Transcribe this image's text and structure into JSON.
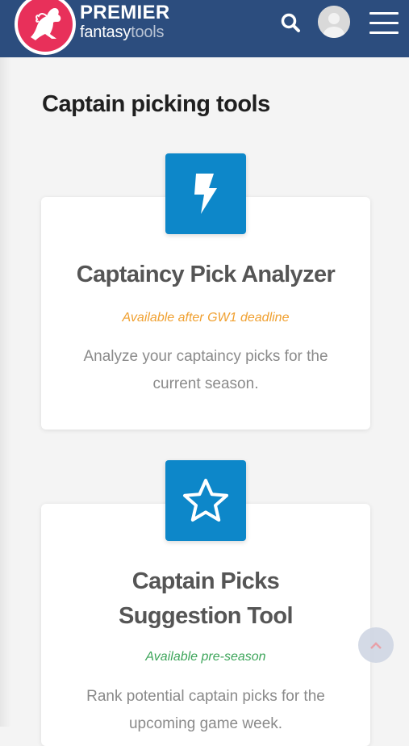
{
  "header": {
    "brand_line1": "PREMIER",
    "brand_fantasy": "fantasy",
    "brand_tools": "tools",
    "icons": [
      "logo-lion-icon",
      "search-icon",
      "avatar-icon",
      "hamburger-menu-icon"
    ],
    "brand_color": "#2c4d7e",
    "logo_color": "#e8305a"
  },
  "page": {
    "title": "Captain picking tools"
  },
  "cards": [
    {
      "icon": "lightning-bolt-icon",
      "title": "Captaincy Pick Analyzer",
      "status": "Available after GW1 deadline",
      "status_color": "#f0a030",
      "description": "Analyze your captaincy picks for the current season."
    },
    {
      "icon": "star-icon",
      "title_line1": "Captain Picks",
      "title_line2": "Suggestion Tool",
      "status": "Available pre-season",
      "status_color": "#3da55a",
      "description": "Rank potential captain picks for the upcoming game week."
    }
  ],
  "colors": {
    "icon_tile": "#0d87c9"
  }
}
